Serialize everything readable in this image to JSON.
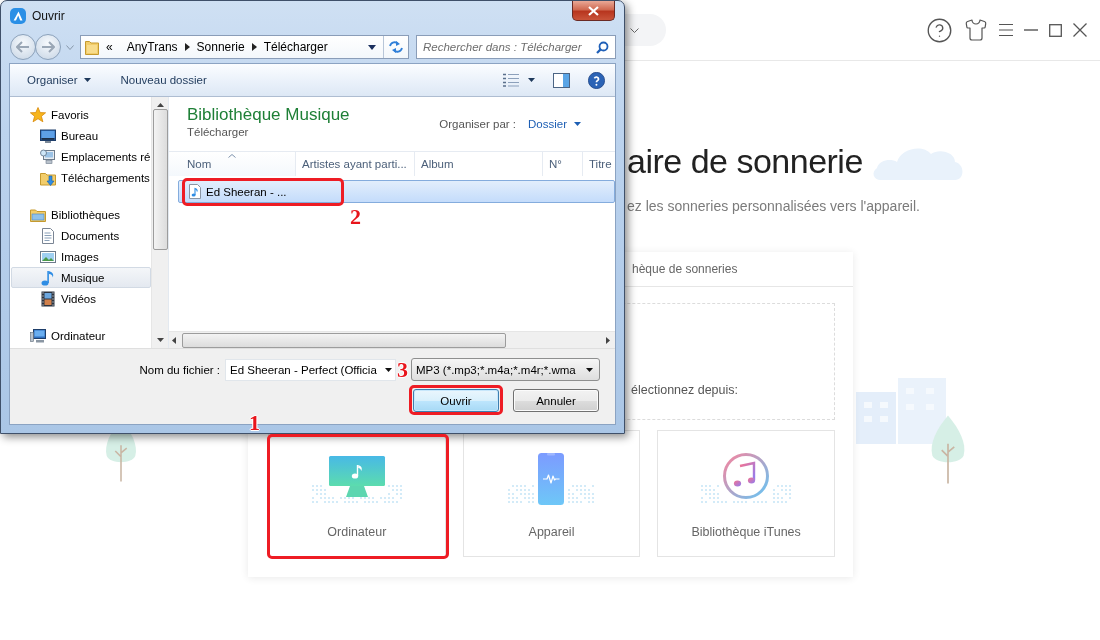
{
  "app": {
    "title": "aire de sonnerie",
    "subtitle": "ez les sonneries personnalisées vers l'appareil.",
    "panel": {
      "tab": "hèque de sonneries",
      "prompt": "électionnez depuis:",
      "sources": [
        {
          "label": "Ordinateur",
          "kind": "computer",
          "highlighted": true,
          "callout": "1"
        },
        {
          "label": "Appareil",
          "kind": "phone",
          "highlighted": false
        },
        {
          "label": "Bibliothèque iTunes",
          "kind": "music-library",
          "highlighted": false
        }
      ]
    }
  },
  "dialog": {
    "title": "Ouvrir",
    "address": {
      "overflow": "«",
      "path": [
        "AnyTrans",
        "Sonnerie",
        "Télécharger"
      ]
    },
    "search": {
      "placeholder": "Rechercher dans : Télécharger"
    },
    "toolbar": [
      {
        "label": "Organiser",
        "kind": "menu"
      },
      {
        "label": "Nouveau dossier",
        "kind": "plain"
      }
    ],
    "nav": [
      {
        "label": "Favoris",
        "kind": "star",
        "selected": false,
        "children": [
          {
            "label": "Bureau",
            "kind": "desktop",
            "selected": false
          },
          {
            "label": "Emplacements ré",
            "kind": "network",
            "selected": false
          },
          {
            "label": "Téléchargements",
            "kind": "downloads",
            "selected": false
          }
        ]
      },
      {
        "label": "Bibliothèques",
        "kind": "libraries",
        "selected": false,
        "children": [
          {
            "label": "Documents",
            "kind": "document",
            "selected": false
          },
          {
            "label": "Images",
            "kind": "picture",
            "selected": false
          },
          {
            "label": "Musique",
            "kind": "music",
            "selected": true
          },
          {
            "label": "Vidéos",
            "kind": "video",
            "selected": false
          }
        ]
      },
      {
        "label": "Ordinateur",
        "kind": "computer",
        "selected": false
      }
    ],
    "library": {
      "title": "Bibliothèque Musique",
      "subtitle": "Télécharger",
      "arrange_label": "Organiser par :",
      "arrange_value": "Dossier"
    },
    "columns": [
      {
        "label": "Nom",
        "sorted": true
      },
      {
        "label": "Artistes ayant parti...",
        "sorted": false
      },
      {
        "label": "Album",
        "sorted": false
      },
      {
        "label": "N°",
        "sorted": false
      },
      {
        "label": "Titre",
        "sorted": false
      }
    ],
    "files": [
      {
        "name": "Ed Sheeran - ...",
        "selected": true,
        "highlighted": true,
        "callout": "2"
      }
    ],
    "file_name": {
      "label": "Nom du fichier :",
      "value": "Ed Sheeran - Perfect (Officia"
    },
    "file_type": "MP3 (*.mp3;*.m4a;*.m4r;*.wma",
    "buttons": [
      {
        "label": "Ouvrir",
        "default": true,
        "highlighted": true,
        "callout": "3"
      },
      {
        "label": "Annuler",
        "default": false,
        "highlighted": false
      }
    ]
  }
}
